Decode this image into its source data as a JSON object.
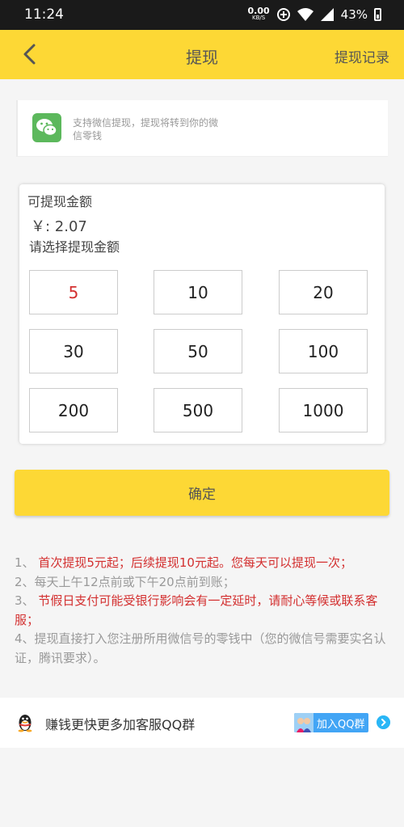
{
  "status_bar": {
    "time": "11:24",
    "net_speed_value": "0.00",
    "net_speed_unit": "KB/S",
    "battery": "43%"
  },
  "header": {
    "title": "提现",
    "records_link": "提现记录"
  },
  "wechat_info": {
    "icon": "wechat-icon",
    "text": "支持微信提现，提现将转到你的微信零钱"
  },
  "withdraw": {
    "available_label": "可提现金额",
    "balance": "￥: 2.07",
    "select_label": "请选择提现金额",
    "amounts": [
      "5",
      "10",
      "20",
      "30",
      "50",
      "100",
      "200",
      "500",
      "1000"
    ],
    "selected_index": 0
  },
  "confirm_label": "确定",
  "notes": [
    {
      "num": "1、",
      "text": " 首次提现5元起；后续提现10元起。您每天可以提现一次；",
      "color": "red"
    },
    {
      "num": "2、",
      "text": "每天上午12点前或下午20点前到账；",
      "color": "gray"
    },
    {
      "num": "3、",
      "text": " 节假日支付可能受银行影响会有一定延时，请耐心等候或联系客服；",
      "color": "red"
    },
    {
      "num": "4、",
      "text": "提现直接打入您注册所用微信号的零钱中（您的微信号需要实名认证，腾讯要求）。",
      "color": "gray"
    }
  ],
  "qq_group": {
    "text": "赚钱更快更多加客服QQ群",
    "join_label": "加入QQ群"
  },
  "colors": {
    "accent_yellow": "#fdd835",
    "highlight_red": "#d32f2f",
    "wechat_green": "#5cb85c",
    "qq_blue": "#42a5f5"
  }
}
